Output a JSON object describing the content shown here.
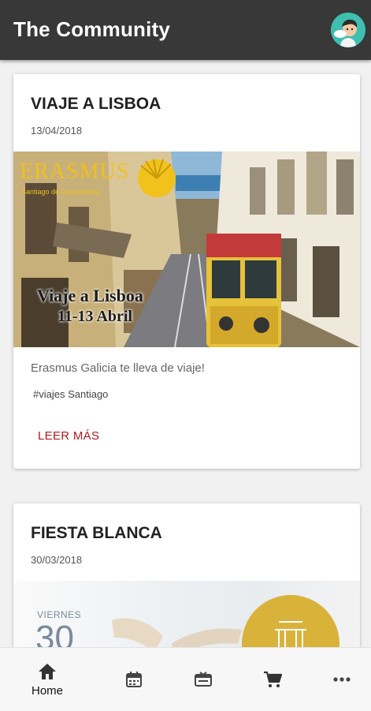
{
  "app": {
    "title": "The Community"
  },
  "posts": [
    {
      "title": "VIAJE A LISBOA",
      "date": "13/04/2018",
      "description": "Erasmus Galicia te lleva de viaje!",
      "tag": "#viajes Santiago",
      "read_more": "LEER MÁS",
      "image": {
        "brand": "ERASMUS",
        "brand_sub": "Santiago de Compostela",
        "overlay_line1": "Viaje a Lisboa",
        "overlay_line2": "11-13 Abril"
      }
    },
    {
      "title": "FIESTA BLANCA",
      "date": "30/03/2018",
      "image": {
        "weekday": "VIERNES",
        "day": "30"
      }
    }
  ],
  "bottom_nav": {
    "items": [
      {
        "icon": "home-icon",
        "label": "Home",
        "active": true
      },
      {
        "icon": "calendar-icon",
        "label": ""
      },
      {
        "icon": "ticket-icon",
        "label": ""
      },
      {
        "icon": "cart-icon",
        "label": ""
      },
      {
        "icon": "more-icon",
        "label": ""
      }
    ]
  },
  "colors": {
    "appbar": "#383838",
    "accent": "#b3181f",
    "avatar_bg": "#3fbfb0"
  }
}
